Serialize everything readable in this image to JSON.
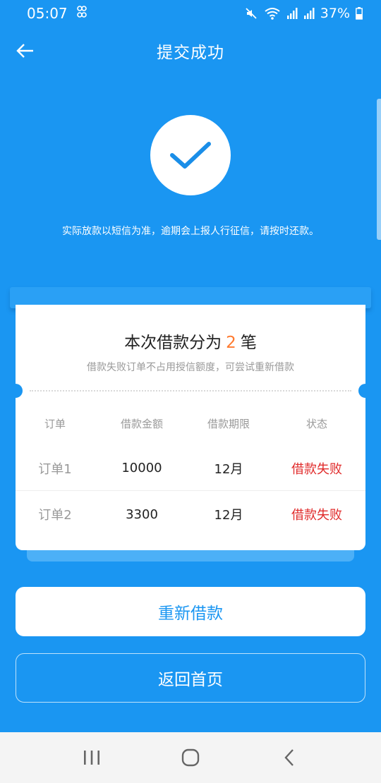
{
  "status_bar": {
    "time": "05:07",
    "battery": "37%"
  },
  "header": {
    "title": "提交成功"
  },
  "notice": {
    "text": "实际放款以短信为准，逾期会上报人行征信，请按时还款。"
  },
  "card": {
    "title_prefix": "本次借款分为",
    "count": "2",
    "title_suffix": "笔",
    "subtitle": "借款失败订单不占用授信额度，可尝试重新借款",
    "columns": [
      "订单",
      "借款金额",
      "借款期限",
      "状态"
    ],
    "rows": [
      {
        "order": "订单1",
        "amount": "10000",
        "term": "12月",
        "status": "借款失败"
      },
      {
        "order": "订单2",
        "amount": "3300",
        "term": "12月",
        "status": "借款失败"
      }
    ]
  },
  "buttons": {
    "retry": "重新借款",
    "home": "返回首页"
  },
  "colors": {
    "background": "#1a96f2",
    "accent_count": "#ff7a2f",
    "status_fail": "#e02b2b"
  }
}
